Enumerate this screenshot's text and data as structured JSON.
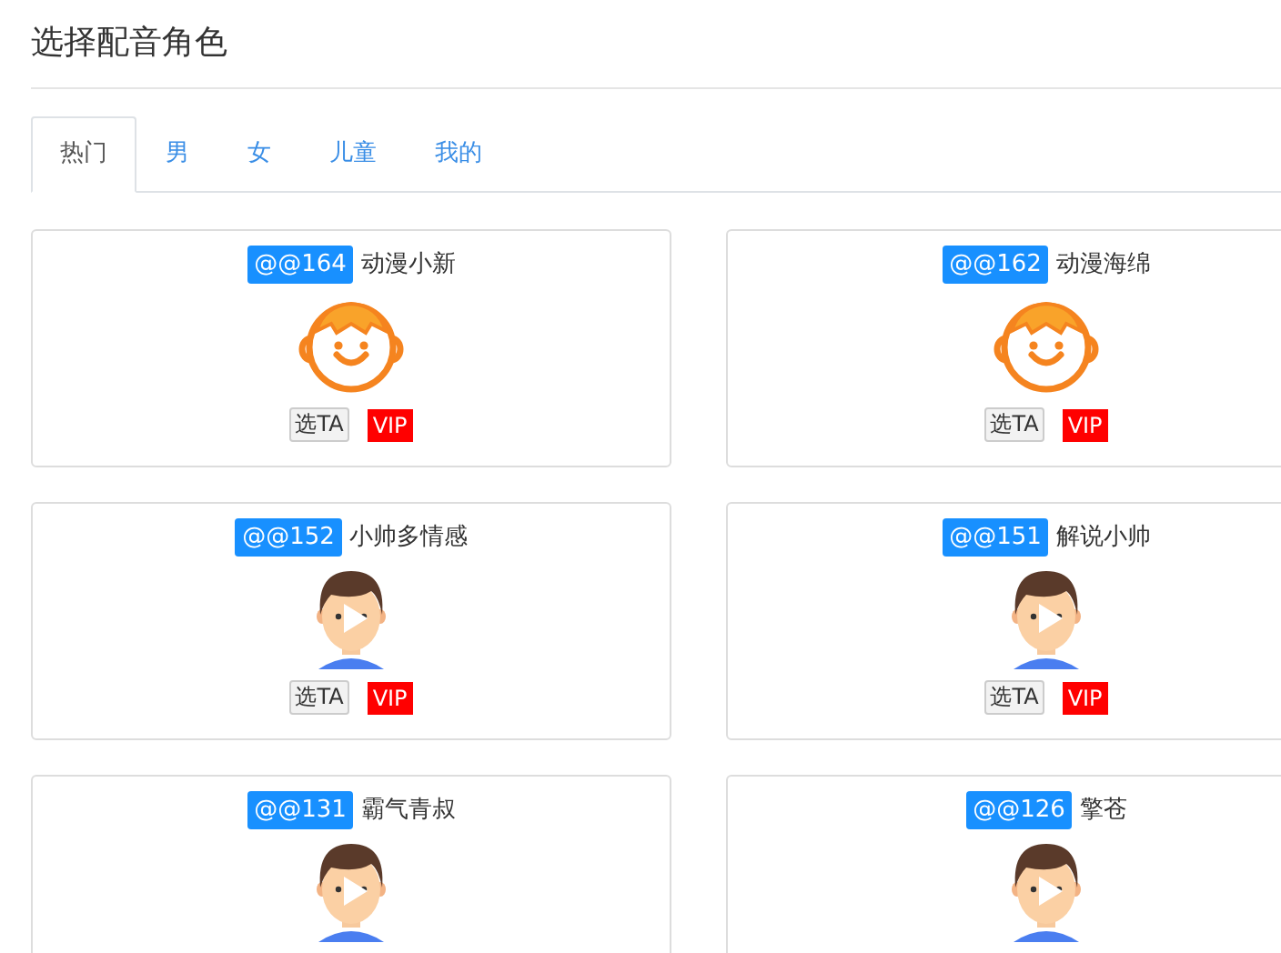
{
  "title": "选择配音角色",
  "tabs": [
    {
      "label": "热门",
      "selected": true
    },
    {
      "label": "男",
      "selected": false
    },
    {
      "label": "女",
      "selected": false
    },
    {
      "label": "儿童",
      "selected": false
    },
    {
      "label": "我的",
      "selected": false
    }
  ],
  "voices": [
    {
      "id": "@@164",
      "name": "动漫小新",
      "kind": "cartoon",
      "select": "选TA",
      "vip": "VIP"
    },
    {
      "id": "@@162",
      "name": "动漫海绵",
      "kind": "cartoon",
      "select": "选TA",
      "vip": "VIP"
    },
    {
      "id": "@@152",
      "name": "小帅多情感",
      "kind": "boy",
      "select": "选TA",
      "vip": "VIP"
    },
    {
      "id": "@@151",
      "name": "解说小帅",
      "kind": "boy",
      "select": "选TA",
      "vip": "VIP"
    },
    {
      "id": "@@131",
      "name": "霸气青叔",
      "kind": "boy"
    },
    {
      "id": "@@126",
      "name": "擎苍",
      "kind": "boy"
    }
  ]
}
